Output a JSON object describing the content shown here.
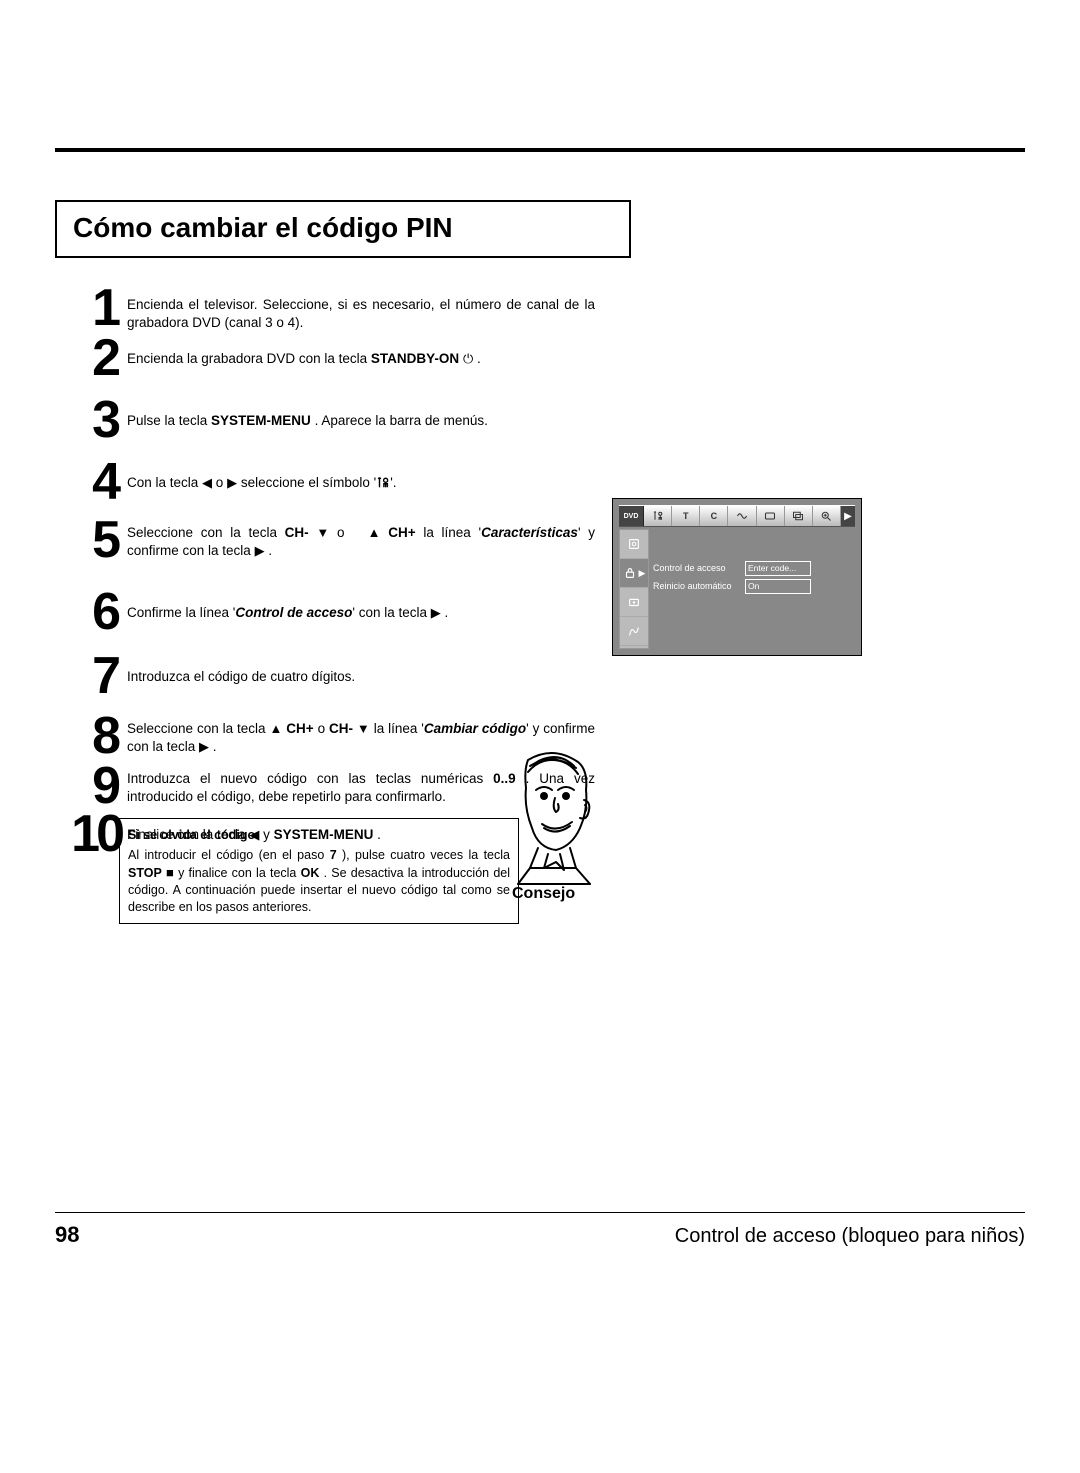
{
  "section_title": "Cómo cambiar el código PIN",
  "steps": {
    "n1": "1",
    "n2": "2",
    "n3": "3",
    "n4": "4",
    "n5": "5",
    "n6": "6",
    "n7": "7",
    "n8": "8",
    "n9": "9",
    "n10": "10",
    "t1": "Encienda el televisor. Seleccione, si es necesario, el número de canal de la grabadora DVD (canal 3 o 4).",
    "t2a": "Encienda la grabadora DVD con la tecla ",
    "t2b": "STANDBY-ON",
    "t2c": " .",
    "t3a": "Pulse la tecla ",
    "t3b": "SYSTEM-MENU",
    "t3c": " . Aparece la barra de menús.",
    "t4a": "Con la tecla ",
    "t4b": " o ",
    "t4c": " seleccione el símbolo '",
    "t4d": "'.",
    "t5a": "Seleccione con la tecla ",
    "t5b": "CH-",
    "t5c": " o ",
    "t5d": "CH+",
    "t5e": " la línea '",
    "t5f": "Características",
    "t5g": "' y confirme con la tecla ",
    "t5h": " .",
    "t6a": "Confirme la línea '",
    "t6b": "Control de acceso",
    "t6c": "' con la tecla ",
    "t6d": " .",
    "t7": "Introduzca el código de cuatro dígitos.",
    "t8a": "Seleccione con la tecla ",
    "t8b": "CH+",
    "t8c": " o ",
    "t8d": "CH-",
    "t8e": " la línea '",
    "t8f": "Cambiar código",
    "t8g": "' y confirme con la tecla ",
    "t8h": " .",
    "t9a": "Introduzca el nuevo código con las teclas numéricas ",
    "t9b": "0..9",
    "t9c": " . Una vez introducido el código, debe repetirlo para confirmarlo.",
    "t10a": "Finalice con la tecla ",
    "t10b": " y ",
    "t10c": "SYSTEM-MENU",
    "t10d": " ."
  },
  "glyphs": {
    "left": "◀",
    "right": "▶",
    "up": "▲",
    "down": "▼",
    "stop": "■",
    "power": "⏻"
  },
  "tip": {
    "title": "Si se olvida el código",
    "a": "Al introducir el código (en el paso ",
    "b": "7",
    "c": " ), pulse cuatro veces la tecla ",
    "d": "STOP",
    "e": " y finalice con la tecla ",
    "f": "OK",
    "g": " . Se desactiva la introducción del código. A continuación puede insertar el nuevo código tal como se describe en los pasos anteriores.",
    "label": "Consejo"
  },
  "osd": {
    "dvd": "DVD",
    "top": [
      "TA",
      "T",
      "C",
      "",
      "",
      "",
      ""
    ],
    "arrow": "▶",
    "rows": [
      {
        "label": "Control de acceso",
        "value": "Enter code..."
      },
      {
        "label": "Reinicio automático",
        "value": "On"
      }
    ]
  },
  "footer": {
    "page": "98",
    "title": "Control de acceso (bloqueo para niños)"
  }
}
